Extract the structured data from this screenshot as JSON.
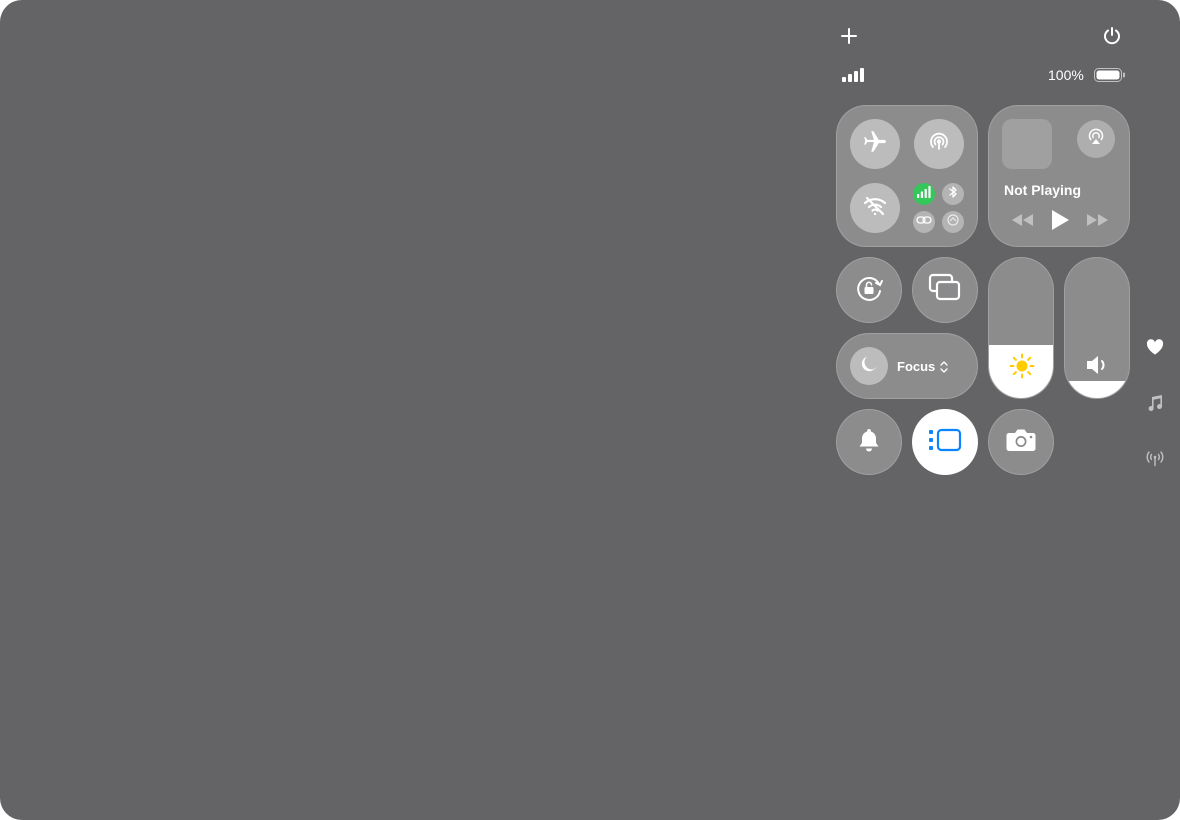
{
  "status_bar": {
    "battery_text": "100%",
    "battery_level": 1.0
  },
  "connectivity": {
    "icons": [
      "airplane-icon",
      "airdrop-icon",
      "wifi-off-icon",
      "cellular-icon",
      "bluetooth-icon",
      "link-icon",
      "vpn-icon"
    ]
  },
  "now_playing": {
    "status": "Not Playing",
    "icons": [
      "airplay-audio-icon",
      "rewind-icon",
      "play-icon",
      "fast-forward-icon"
    ]
  },
  "focus": {
    "label": "Focus"
  },
  "sliders": {
    "brightness_level": 0.38,
    "volume_level": 0.12
  },
  "colors": {
    "background": "#646466",
    "cellular_active": "#34c759",
    "brightness_icon": "#ffcc00",
    "stage_manager_accent": "#0a84ff"
  },
  "side_icons": [
    "heart-icon",
    "music-note-icon",
    "antenna-icon"
  ]
}
